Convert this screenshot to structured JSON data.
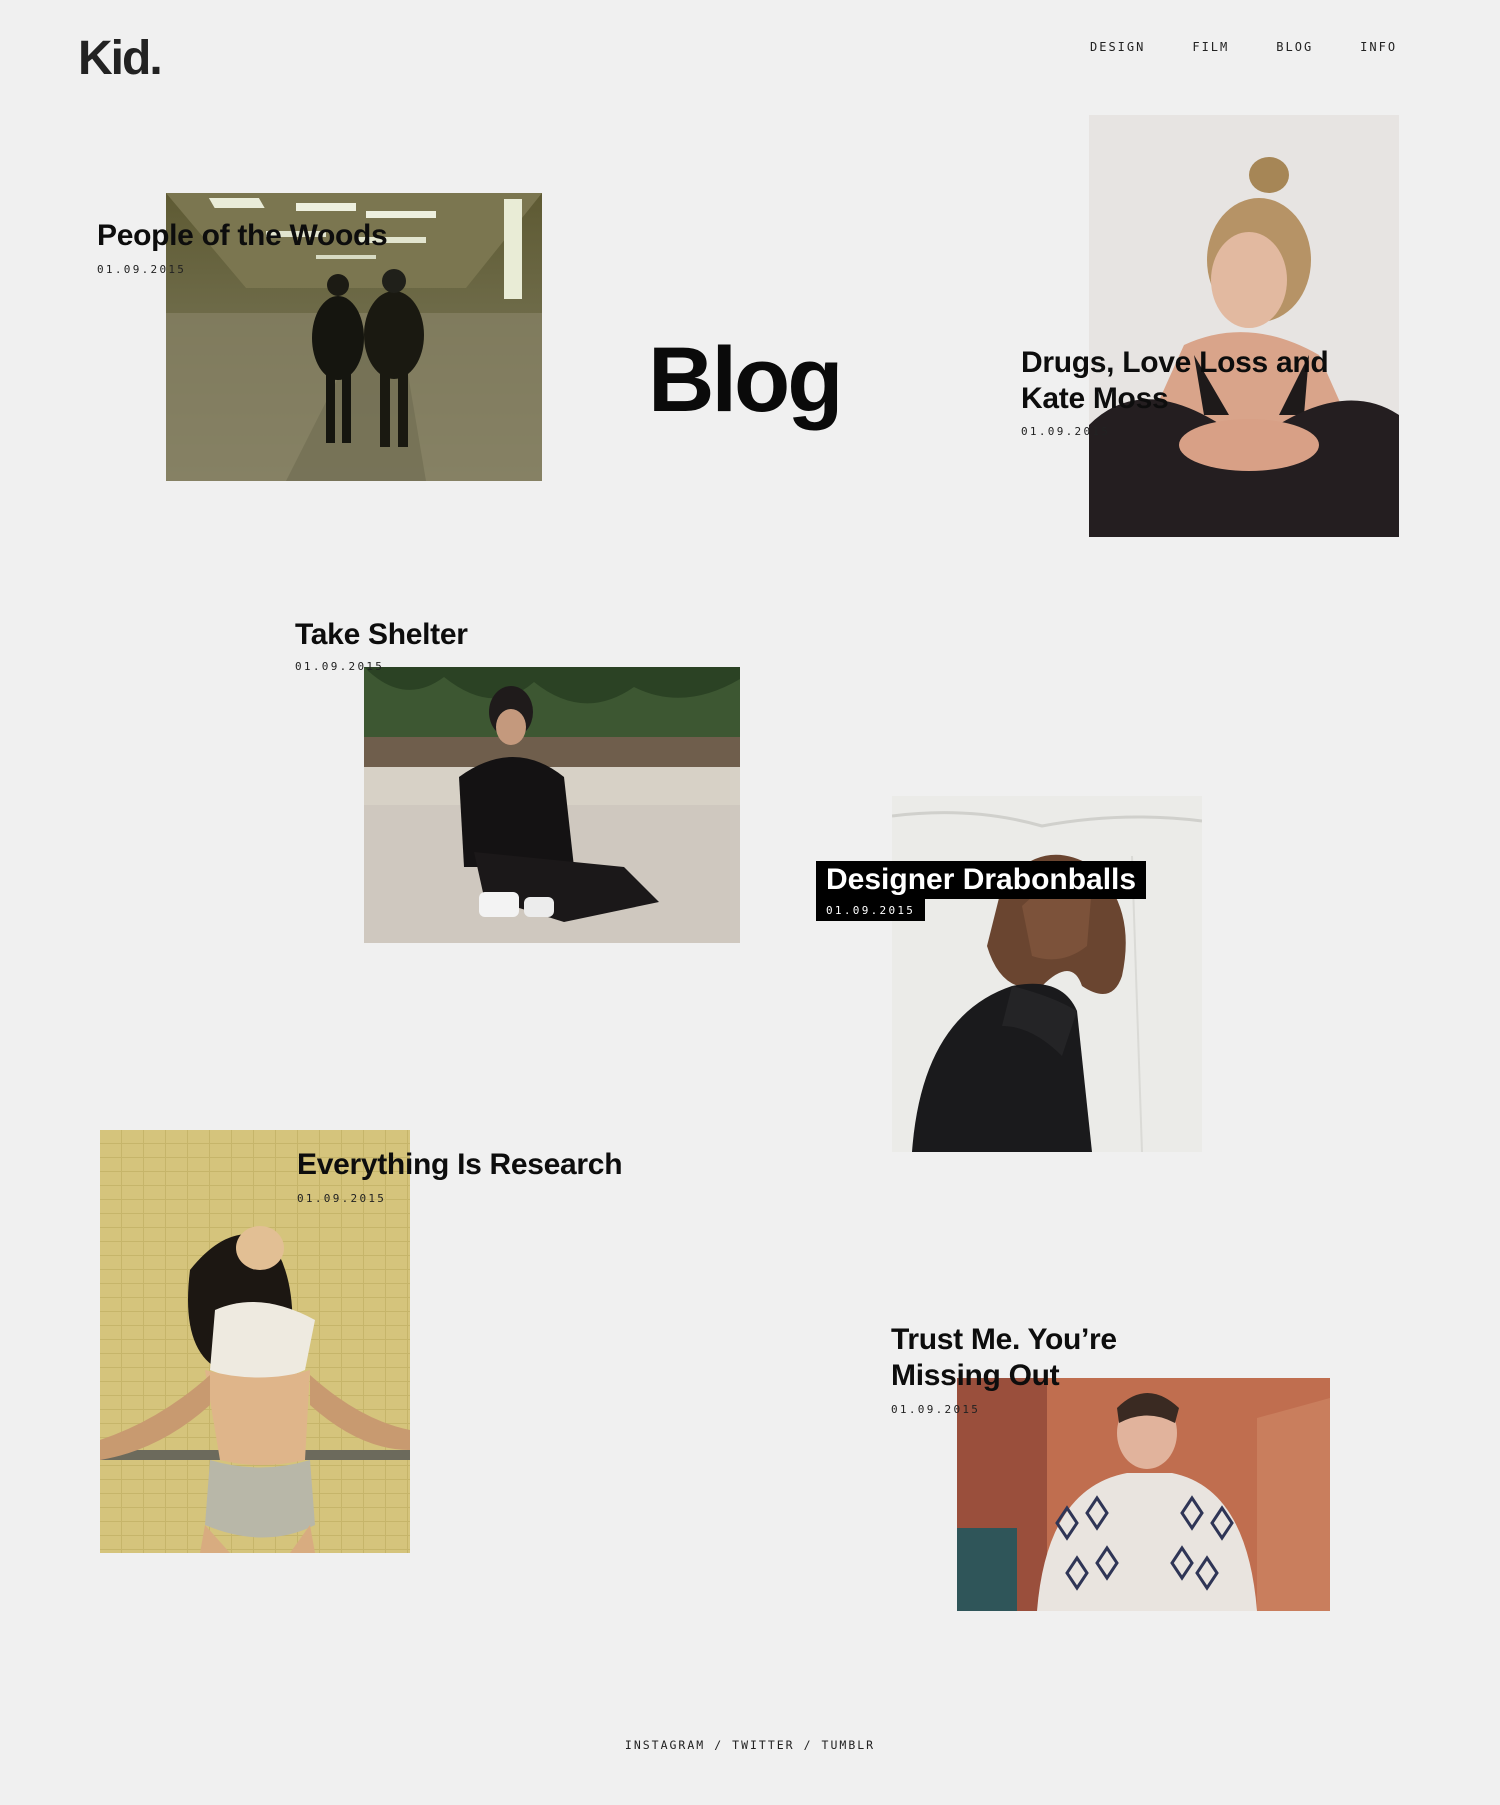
{
  "brand": {
    "logo": "Kid."
  },
  "nav": {
    "items": [
      "DESIGN",
      "FILM",
      "BLOG",
      "INFO"
    ]
  },
  "page": {
    "title": "Blog"
  },
  "posts": [
    {
      "title": "People of the Woods",
      "date": "01.09.2015"
    },
    {
      "title": "Drugs, Love Loss and Kate Moss",
      "date": "01.09.2015"
    },
    {
      "title": "Take Shelter",
      "date": "01.09.2015"
    },
    {
      "title": "Designer Drabonballs",
      "date": "01.09.2015"
    },
    {
      "title": "Everything Is Research",
      "date": "01.09.2015"
    },
    {
      "title": "Trust Me. You’re Missing Out",
      "date": "01.09.2015"
    }
  ],
  "footer": {
    "links": [
      "INSTAGRAM",
      "TWITTER",
      "TUMBLR"
    ],
    "separator": "/"
  }
}
